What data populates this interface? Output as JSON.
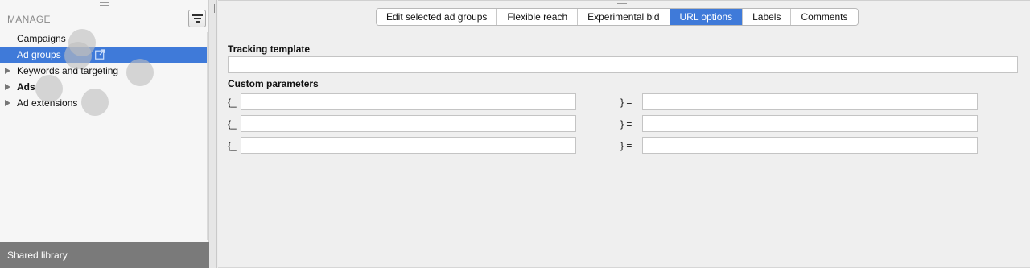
{
  "sidebar": {
    "header": "MANAGE",
    "filter_icon": "filter-icon",
    "items": [
      {
        "label": "Campaigns",
        "expandable": false,
        "selected": false,
        "bold": false
      },
      {
        "label": "Ad groups",
        "expandable": false,
        "selected": true,
        "bold": false,
        "icon": "external-link-icon"
      },
      {
        "label": "Keywords and targeting",
        "expandable": true,
        "selected": false,
        "bold": false
      },
      {
        "label": "Ads",
        "expandable": true,
        "selected": false,
        "bold": true
      },
      {
        "label": "Ad extensions",
        "expandable": true,
        "selected": false,
        "bold": false
      }
    ],
    "footer": "Shared library"
  },
  "tabs": [
    {
      "label": "Edit selected ad groups",
      "active": false
    },
    {
      "label": "Flexible reach",
      "active": false
    },
    {
      "label": "Experimental bid",
      "active": false
    },
    {
      "label": "URL options",
      "active": true
    },
    {
      "label": "Labels",
      "active": false
    },
    {
      "label": "Comments",
      "active": false
    }
  ],
  "form": {
    "tracking_template_label": "Tracking template",
    "tracking_template_value": "",
    "custom_parameters_label": "Custom parameters",
    "param_prefix": "{_",
    "param_suffix": "} =",
    "params": [
      {
        "key": "",
        "value": ""
      },
      {
        "key": "",
        "value": ""
      },
      {
        "key": "",
        "value": ""
      }
    ]
  },
  "colors": {
    "selection": "#3f7ad9",
    "footer": "#7a7a7a"
  }
}
